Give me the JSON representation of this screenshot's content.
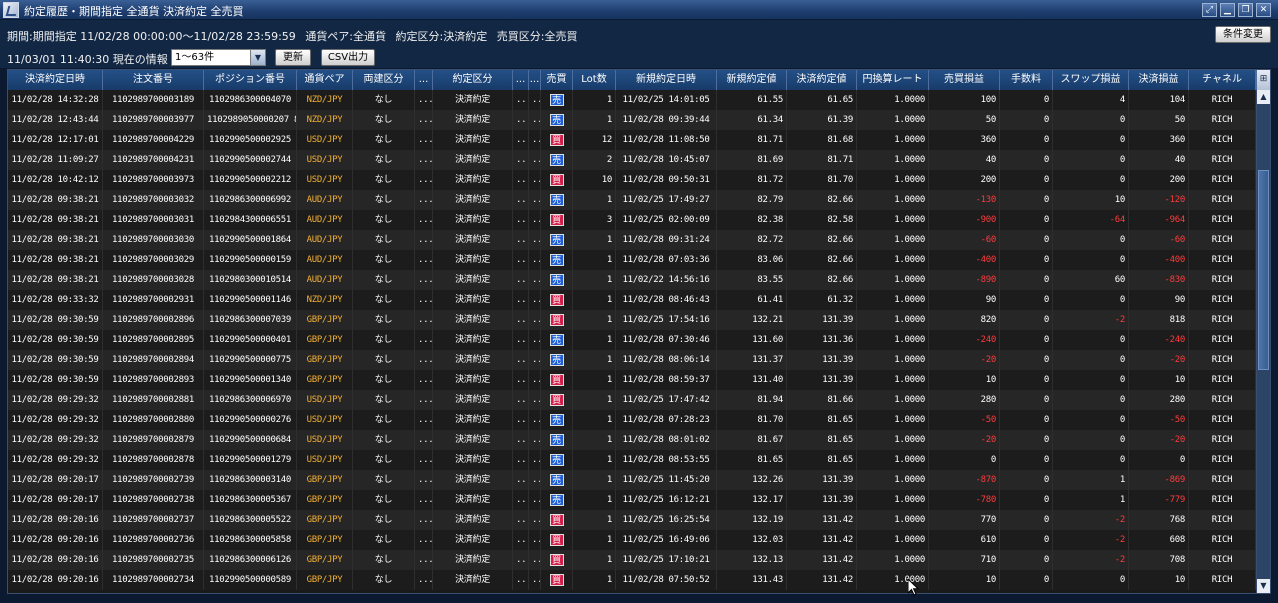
{
  "window": {
    "title": "約定履歴・期間指定 全通貨 決済約定 全売買",
    "controls": [
      "⤢",
      "▁",
      "❐",
      "✕"
    ]
  },
  "info": {
    "period": "期間:期間指定  11/02/28 00:00:00〜11/02/28 23:59:59",
    "pair": "通貨ペア:全通貨",
    "type": "約定区分:決済約定",
    "side": "売買区分:全売買",
    "condition_button": "条件変更",
    "current": "11/03/01 11:40:30 現在の情報",
    "range_value": "1〜63件",
    "refresh_button": "更新",
    "csv_button": "CSV出力"
  },
  "columns": [
    "決済約定日時",
    "注文番号",
    "ポジション番号",
    "通貨ペア",
    "両建区分",
    "...",
    "約定区分",
    "...",
    "...",
    "売買",
    "Lot数",
    "新規約定日時",
    "新規約定値",
    "決済約定値",
    "円換算レート",
    "売買損益",
    "手数料",
    "スワップ損益",
    "決済損益",
    "チャネル"
  ],
  "corner_icon": "column-settings-icon",
  "labels": {
    "sell": "売",
    "buy": "買"
  },
  "rows": [
    {
      "dt": "11/02/28 14:32:28",
      "order": "1102989700003189",
      "pos": "1102986300004070",
      "pair": "NZD/JPY",
      "hedge": "なし",
      "x1": "...",
      "type": "決済約定",
      "x2": "...6...",
      "x3": "...",
      "side": "sell",
      "lot": "1",
      "ndt": "11/02/25 14:01:05",
      "nprice": "61.55",
      "cprice": "61.65",
      "rate": "1.0000",
      "pl": "100",
      "fee": "0",
      "swap": "4",
      "net": "104",
      "ch": "RICH"
    },
    {
      "dt": "11/02/28 12:43:44",
      "order": "1102989700003977",
      "pos": "1102989050000207 8",
      "pair": "NZD/JPY",
      "hedge": "なし",
      "x1": "...",
      "type": "決済約定",
      "x2": "...6...",
      "x3": "...",
      "side": "sell",
      "lot": "1",
      "ndt": "11/02/28 09:39:44",
      "nprice": "61.34",
      "cprice": "61.39",
      "rate": "1.0000",
      "pl": "50",
      "fee": "0",
      "swap": "0",
      "net": "50",
      "ch": "RICH"
    },
    {
      "dt": "11/02/28 12:17:01",
      "order": "1102989700004229",
      "pos": "1102990500002925",
      "pair": "USD/JPY",
      "hedge": "なし",
      "x1": "...",
      "type": "決済約定",
      "x2": "...8...",
      "x3": "...",
      "side": "buy",
      "lot": "12",
      "ndt": "11/02/28 11:08:50",
      "nprice": "81.71",
      "cprice": "81.68",
      "rate": "1.0000",
      "pl": "360",
      "fee": "0",
      "swap": "0",
      "net": "360",
      "ch": "RICH"
    },
    {
      "dt": "11/02/28 11:09:27",
      "order": "1102989700004231",
      "pos": "1102990500002744",
      "pair": "USD/JPY",
      "hedge": "なし",
      "x1": "...",
      "type": "決済約定",
      "x2": "...",
      "x3": "...",
      "side": "sell",
      "lot": "2",
      "ndt": "11/02/28 10:45:07",
      "nprice": "81.69",
      "cprice": "81.71",
      "rate": "1.0000",
      "pl": "40",
      "fee": "0",
      "swap": "0",
      "net": "40",
      "ch": "RICH"
    },
    {
      "dt": "11/02/28 10:42:12",
      "order": "1102989700003973",
      "pos": "1102990500002212",
      "pair": "USD/JPY",
      "hedge": "なし",
      "x1": "...",
      "type": "決済約定",
      "x2": "...",
      "x3": "...",
      "side": "buy",
      "lot": "10",
      "ndt": "11/02/28 09:50:31",
      "nprice": "81.72",
      "cprice": "81.70",
      "rate": "1.0000",
      "pl": "200",
      "fee": "0",
      "swap": "0",
      "net": "200",
      "ch": "RICH"
    },
    {
      "dt": "11/02/28 09:38:21",
      "order": "1102989700003032",
      "pos": "1102986300006992",
      "pair": "AUD/JPY",
      "hedge": "なし",
      "x1": "...",
      "type": "決済約定",
      "x2": "...",
      "x3": "...",
      "side": "sell",
      "lot": "1",
      "ndt": "11/02/25 17:49:27",
      "nprice": "82.79",
      "cprice": "82.66",
      "rate": "1.0000",
      "pl": "-130",
      "fee": "0",
      "swap": "10",
      "net": "-120",
      "ch": "RICH"
    },
    {
      "dt": "11/02/28 09:38:21",
      "order": "1102989700003031",
      "pos": "1102984300006551",
      "pair": "AUD/JPY",
      "hedge": "なし",
      "x1": "...",
      "type": "決済約定",
      "x2": "...",
      "x3": "...",
      "side": "buy",
      "lot": "3",
      "ndt": "11/02/25 02:00:09",
      "nprice": "82.38",
      "cprice": "82.58",
      "rate": "1.0000",
      "pl": "-900",
      "fee": "0",
      "swap": "-64",
      "net": "-964",
      "ch": "RICH"
    },
    {
      "dt": "11/02/28 09:38:21",
      "order": "1102989700003030",
      "pos": "1102990500001864",
      "pair": "AUD/JPY",
      "hedge": "なし",
      "x1": "...",
      "type": "決済約定",
      "x2": "...",
      "x3": "...",
      "side": "sell",
      "lot": "1",
      "ndt": "11/02/28 09:31:24",
      "nprice": "82.72",
      "cprice": "82.66",
      "rate": "1.0000",
      "pl": "-60",
      "fee": "0",
      "swap": "0",
      "net": "-60",
      "ch": "RICH"
    },
    {
      "dt": "11/02/28 09:38:21",
      "order": "1102989700003029",
      "pos": "1102990500000159",
      "pair": "AUD/JPY",
      "hedge": "なし",
      "x1": "...",
      "type": "決済約定",
      "x2": "...",
      "x3": "...",
      "side": "sell",
      "lot": "1",
      "ndt": "11/02/28 07:03:36",
      "nprice": "83.06",
      "cprice": "82.66",
      "rate": "1.0000",
      "pl": "-400",
      "fee": "0",
      "swap": "0",
      "net": "-400",
      "ch": "RICH"
    },
    {
      "dt": "11/02/28 09:38:21",
      "order": "1102989700003028",
      "pos": "1102980300010514",
      "pair": "AUD/JPY",
      "hedge": "なし",
      "x1": "...",
      "type": "決済約定",
      "x2": "...",
      "x3": "...",
      "side": "sell",
      "lot": "1",
      "ndt": "11/02/22 14:56:16",
      "nprice": "83.55",
      "cprice": "82.66",
      "rate": "1.0000",
      "pl": "-890",
      "fee": "0",
      "swap": "60",
      "net": "-830",
      "ch": "RICH"
    },
    {
      "dt": "11/02/28 09:33:32",
      "order": "1102989700002931",
      "pos": "1102990500001146",
      "pair": "NZD/JPY",
      "hedge": "なし",
      "x1": "...",
      "type": "決済約定",
      "x2": "...",
      "x3": "...",
      "side": "buy",
      "lot": "1",
      "ndt": "11/02/28 08:46:43",
      "nprice": "61.41",
      "cprice": "61.32",
      "rate": "1.0000",
      "pl": "90",
      "fee": "0",
      "swap": "0",
      "net": "90",
      "ch": "RICH"
    },
    {
      "dt": "11/02/28 09:30:59",
      "order": "1102989700002896",
      "pos": "1102986300007039",
      "pair": "GBP/JPY",
      "hedge": "なし",
      "x1": "...",
      "type": "決済約定",
      "x2": "...",
      "x3": "...",
      "side": "buy",
      "lot": "1",
      "ndt": "11/02/25 17:54:16",
      "nprice": "132.21",
      "cprice": "131.39",
      "rate": "1.0000",
      "pl": "820",
      "fee": "0",
      "swap": "-2",
      "net": "818",
      "ch": "RICH"
    },
    {
      "dt": "11/02/28 09:30:59",
      "order": "1102989700002895",
      "pos": "1102990500000401",
      "pair": "GBP/JPY",
      "hedge": "なし",
      "x1": "...",
      "type": "決済約定",
      "x2": "...",
      "x3": "...",
      "side": "sell",
      "lot": "1",
      "ndt": "11/02/28 07:30:46",
      "nprice": "131.60",
      "cprice": "131.36",
      "rate": "1.0000",
      "pl": "-240",
      "fee": "0",
      "swap": "0",
      "net": "-240",
      "ch": "RICH"
    },
    {
      "dt": "11/02/28 09:30:59",
      "order": "1102989700002894",
      "pos": "1102990500000775",
      "pair": "GBP/JPY",
      "hedge": "なし",
      "x1": "...",
      "type": "決済約定",
      "x2": "...",
      "x3": "...",
      "side": "sell",
      "lot": "1",
      "ndt": "11/02/28 08:06:14",
      "nprice": "131.37",
      "cprice": "131.39",
      "rate": "1.0000",
      "pl": "-20",
      "fee": "0",
      "swap": "0",
      "net": "-20",
      "ch": "RICH"
    },
    {
      "dt": "11/02/28 09:30:59",
      "order": "1102989700002893",
      "pos": "1102990500001340",
      "pair": "GBP/JPY",
      "hedge": "なし",
      "x1": "...",
      "type": "決済約定",
      "x2": "...",
      "x3": "...",
      "side": "buy",
      "lot": "1",
      "ndt": "11/02/28 08:59:37",
      "nprice": "131.40",
      "cprice": "131.39",
      "rate": "1.0000",
      "pl": "10",
      "fee": "0",
      "swap": "0",
      "net": "10",
      "ch": "RICH"
    },
    {
      "dt": "11/02/28 09:29:32",
      "order": "1102989700002881",
      "pos": "1102986300006970",
      "pair": "USD/JPY",
      "hedge": "なし",
      "x1": "...",
      "type": "決済約定",
      "x2": "...",
      "x3": "...",
      "side": "buy",
      "lot": "1",
      "ndt": "11/02/25 17:47:42",
      "nprice": "81.94",
      "cprice": "81.66",
      "rate": "1.0000",
      "pl": "280",
      "fee": "0",
      "swap": "0",
      "net": "280",
      "ch": "RICH"
    },
    {
      "dt": "11/02/28 09:29:32",
      "order": "1102989700002880",
      "pos": "1102990500000276",
      "pair": "USD/JPY",
      "hedge": "なし",
      "x1": "...",
      "type": "決済約定",
      "x2": "...",
      "x3": "...",
      "side": "sell",
      "lot": "1",
      "ndt": "11/02/28 07:28:23",
      "nprice": "81.70",
      "cprice": "81.65",
      "rate": "1.0000",
      "pl": "-50",
      "fee": "0",
      "swap": "0",
      "net": "-50",
      "ch": "RICH"
    },
    {
      "dt": "11/02/28 09:29:32",
      "order": "1102989700002879",
      "pos": "1102990500000684",
      "pair": "USD/JPY",
      "hedge": "なし",
      "x1": "...",
      "type": "決済約定",
      "x2": "...",
      "x3": "...",
      "side": "sell",
      "lot": "1",
      "ndt": "11/02/28 08:01:02",
      "nprice": "81.67",
      "cprice": "81.65",
      "rate": "1.0000",
      "pl": "-20",
      "fee": "0",
      "swap": "0",
      "net": "-20",
      "ch": "RICH"
    },
    {
      "dt": "11/02/28 09:29:32",
      "order": "1102989700002878",
      "pos": "1102990500001279",
      "pair": "USD/JPY",
      "hedge": "なし",
      "x1": "...",
      "type": "決済約定",
      "x2": "...",
      "x3": "...",
      "side": "sell",
      "lot": "1",
      "ndt": "11/02/28 08:53:55",
      "nprice": "81.65",
      "cprice": "81.65",
      "rate": "1.0000",
      "pl": "0",
      "fee": "0",
      "swap": "0",
      "net": "0",
      "ch": "RICH"
    },
    {
      "dt": "11/02/28 09:20:17",
      "order": "1102989700002739",
      "pos": "1102986300003140",
      "pair": "GBP/JPY",
      "hedge": "なし",
      "x1": "...",
      "type": "決済約定",
      "x2": "...",
      "x3": "...",
      "side": "sell",
      "lot": "1",
      "ndt": "11/02/25 11:45:20",
      "nprice": "132.26",
      "cprice": "131.39",
      "rate": "1.0000",
      "pl": "-870",
      "fee": "0",
      "swap": "1",
      "net": "-869",
      "ch": "RICH"
    },
    {
      "dt": "11/02/28 09:20:17",
      "order": "1102989700002738",
      "pos": "1102986300005367",
      "pair": "GBP/JPY",
      "hedge": "なし",
      "x1": "...",
      "type": "決済約定",
      "x2": "...",
      "x3": "...",
      "side": "sell",
      "lot": "1",
      "ndt": "11/02/25 16:12:21",
      "nprice": "132.17",
      "cprice": "131.39",
      "rate": "1.0000",
      "pl": "-780",
      "fee": "0",
      "swap": "1",
      "net": "-779",
      "ch": "RICH"
    },
    {
      "dt": "11/02/28 09:20:16",
      "order": "1102989700002737",
      "pos": "1102986300005522",
      "pair": "GBP/JPY",
      "hedge": "なし",
      "x1": "...",
      "type": "決済約定",
      "x2": "...",
      "x3": "...",
      "side": "buy",
      "lot": "1",
      "ndt": "11/02/25 16:25:54",
      "nprice": "132.19",
      "cprice": "131.42",
      "rate": "1.0000",
      "pl": "770",
      "fee": "0",
      "swap": "-2",
      "net": "768",
      "ch": "RICH"
    },
    {
      "dt": "11/02/28 09:20:16",
      "order": "1102989700002736",
      "pos": "1102986300005858",
      "pair": "GBP/JPY",
      "hedge": "なし",
      "x1": "...",
      "type": "決済約定",
      "x2": "...",
      "x3": "...",
      "side": "buy",
      "lot": "1",
      "ndt": "11/02/25 16:49:06",
      "nprice": "132.03",
      "cprice": "131.42",
      "rate": "1.0000",
      "pl": "610",
      "fee": "0",
      "swap": "-2",
      "net": "608",
      "ch": "RICH"
    },
    {
      "dt": "11/02/28 09:20:16",
      "order": "1102989700002735",
      "pos": "1102986300006126",
      "pair": "GBP/JPY",
      "hedge": "なし",
      "x1": "...",
      "type": "決済約定",
      "x2": "...",
      "x3": "...",
      "side": "buy",
      "lot": "1",
      "ndt": "11/02/25 17:10:21",
      "nprice": "132.13",
      "cprice": "131.42",
      "rate": "1.0000",
      "pl": "710",
      "fee": "0",
      "swap": "-2",
      "net": "708",
      "ch": "RICH"
    },
    {
      "dt": "11/02/28 09:20:16",
      "order": "1102989700002734",
      "pos": "1102990500000589",
      "pair": "GBP/JPY",
      "hedge": "なし",
      "x1": "...",
      "type": "決済約定",
      "x2": "...",
      "x3": "...",
      "side": "buy",
      "lot": "1",
      "ndt": "11/02/28 07:50:52",
      "nprice": "131.43",
      "cprice": "131.42",
      "rate": "1.0000",
      "pl": "10",
      "fee": "0",
      "swap": "0",
      "net": "10",
      "ch": "RICH"
    }
  ]
}
